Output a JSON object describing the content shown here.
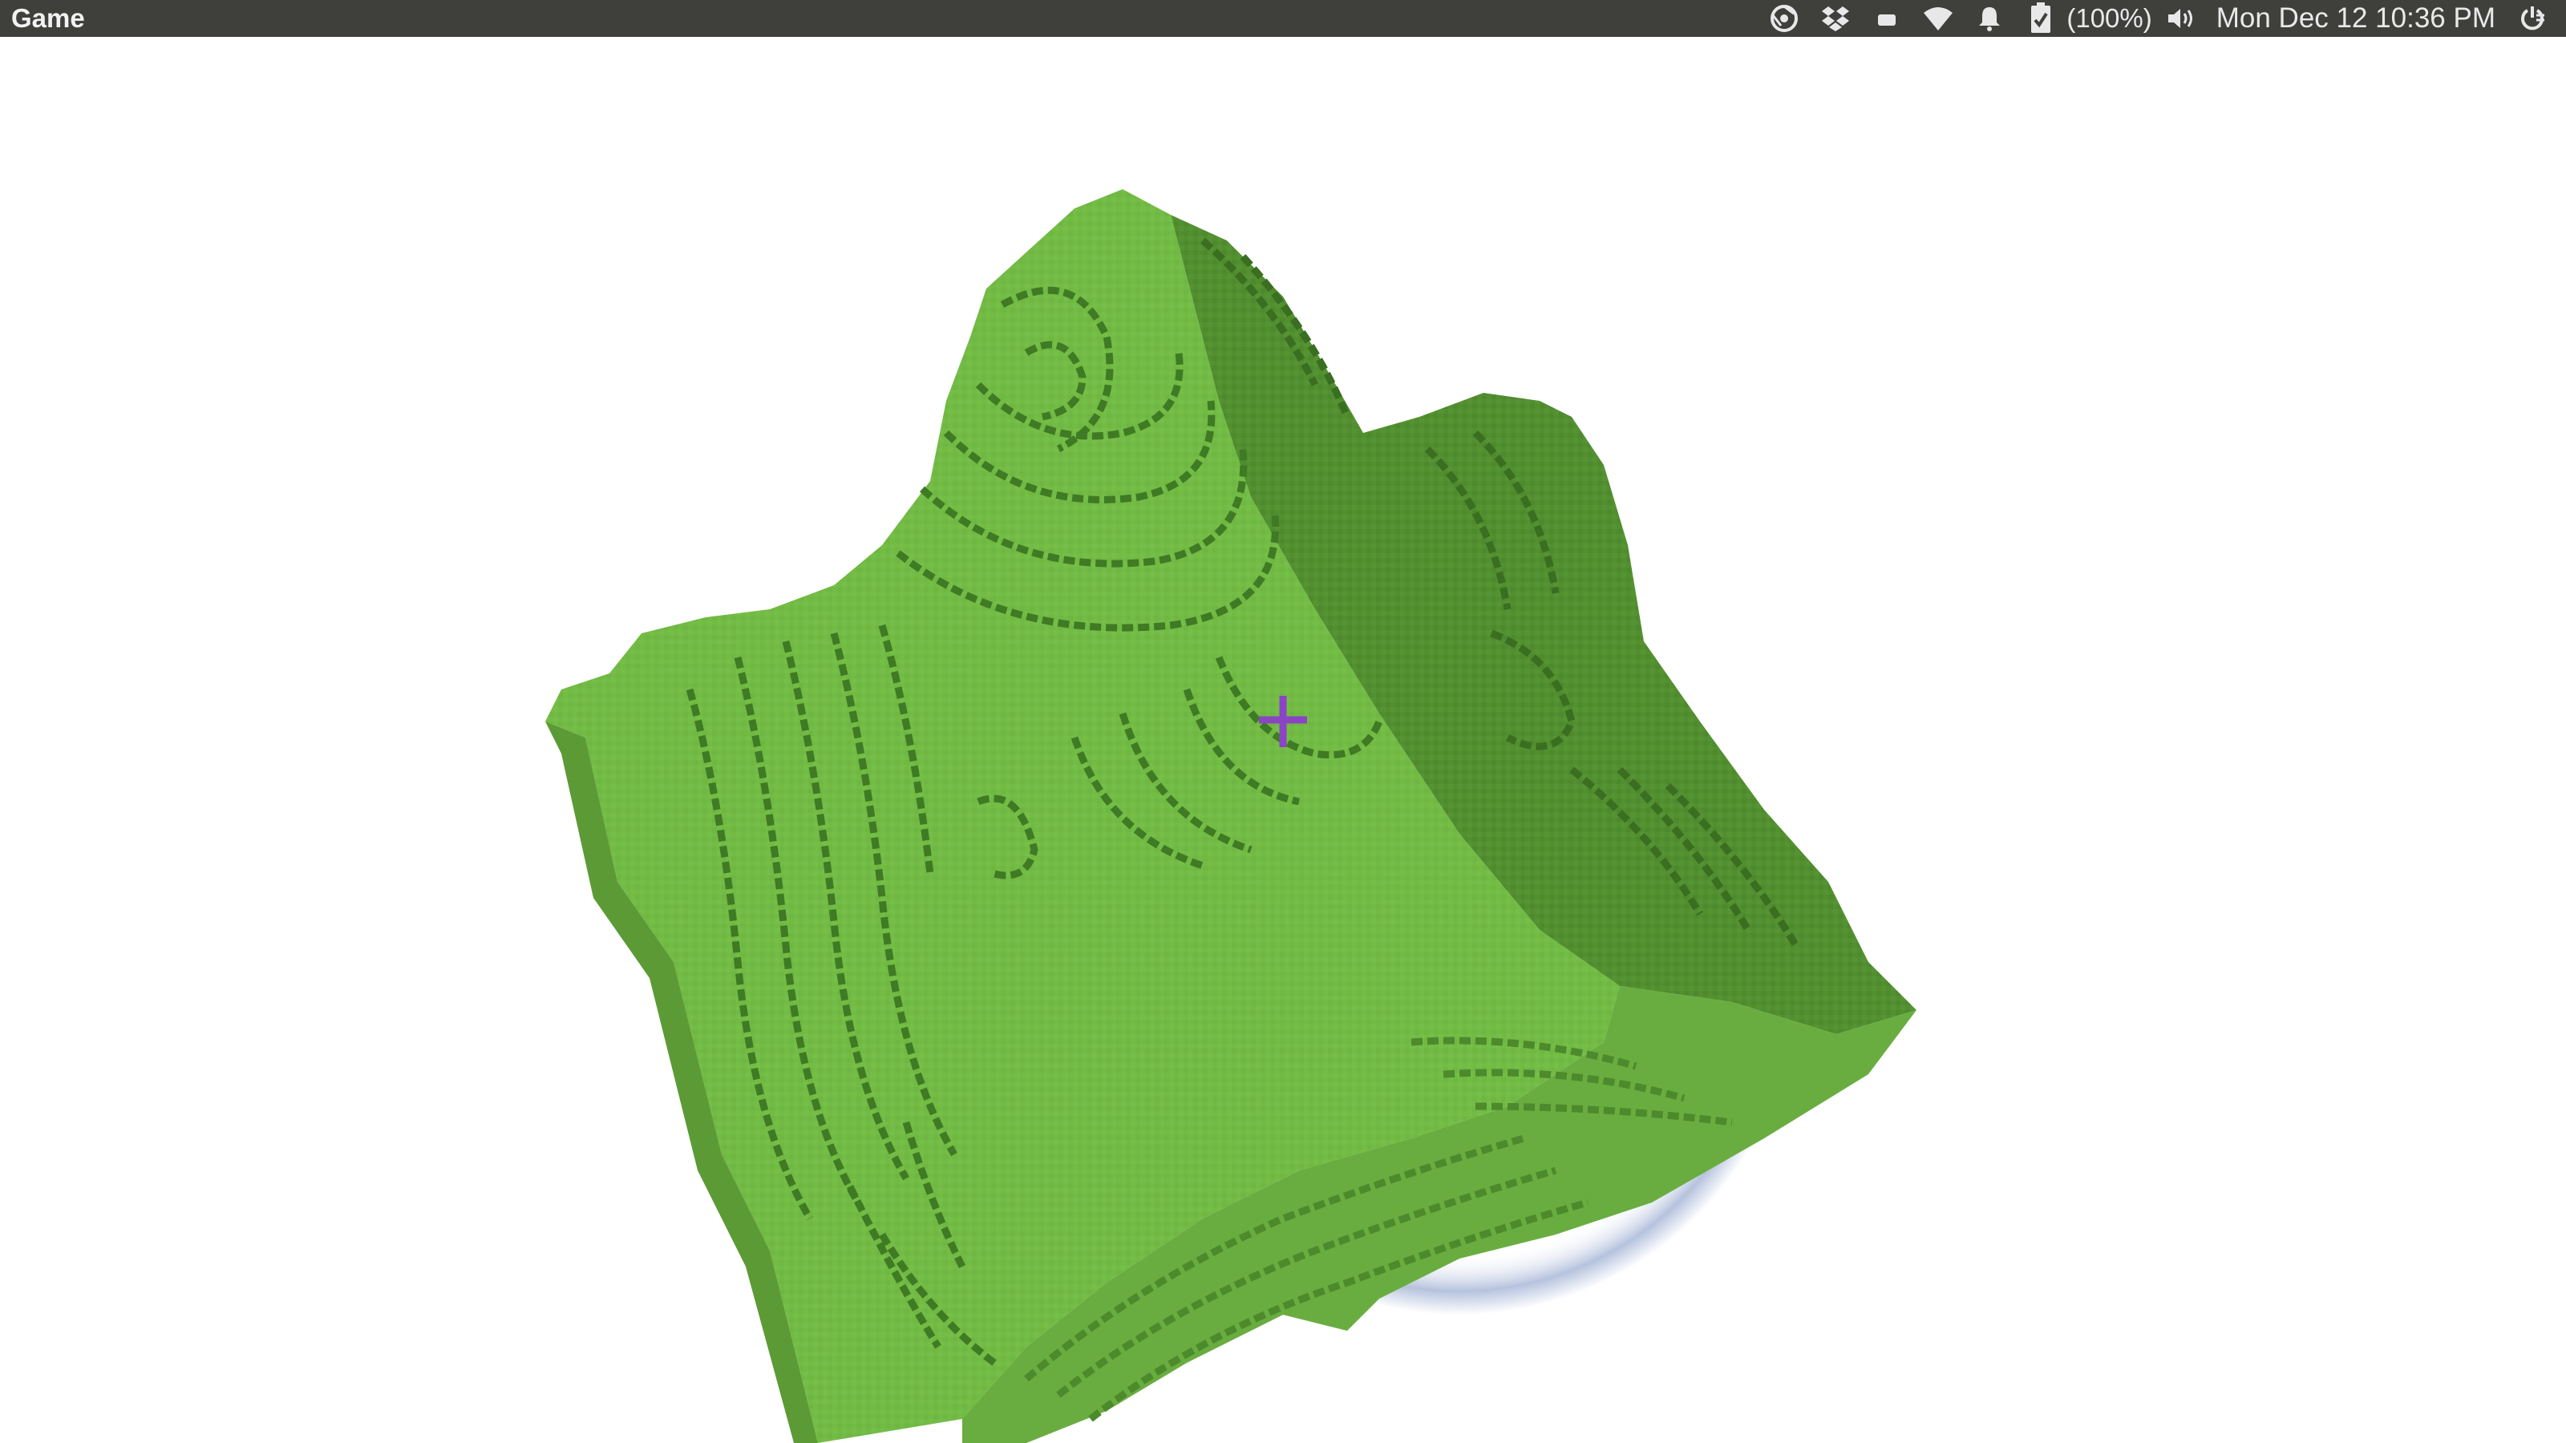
{
  "window": {
    "app_title": "Game"
  },
  "tray": {
    "icons": [
      "chrome-icon",
      "dropbox-icon",
      "keyboard-icon",
      "wifi-icon",
      "notification-bell-icon",
      "battery-icon",
      "volume-icon",
      "power-icon"
    ],
    "battery_percent": "(100%)",
    "clock": "Mon Dec 12 10:36 PM"
  },
  "scene": {
    "sky_color": "#ffffff",
    "grass_top_color": "#72bb45",
    "grass_side_color": "#5c9a35",
    "grass_dark_color": "#4c8a2c",
    "contour_color": "#3f7a24",
    "halo_color": "#a9b8d8",
    "crosshair_color": "#8a44c4"
  }
}
